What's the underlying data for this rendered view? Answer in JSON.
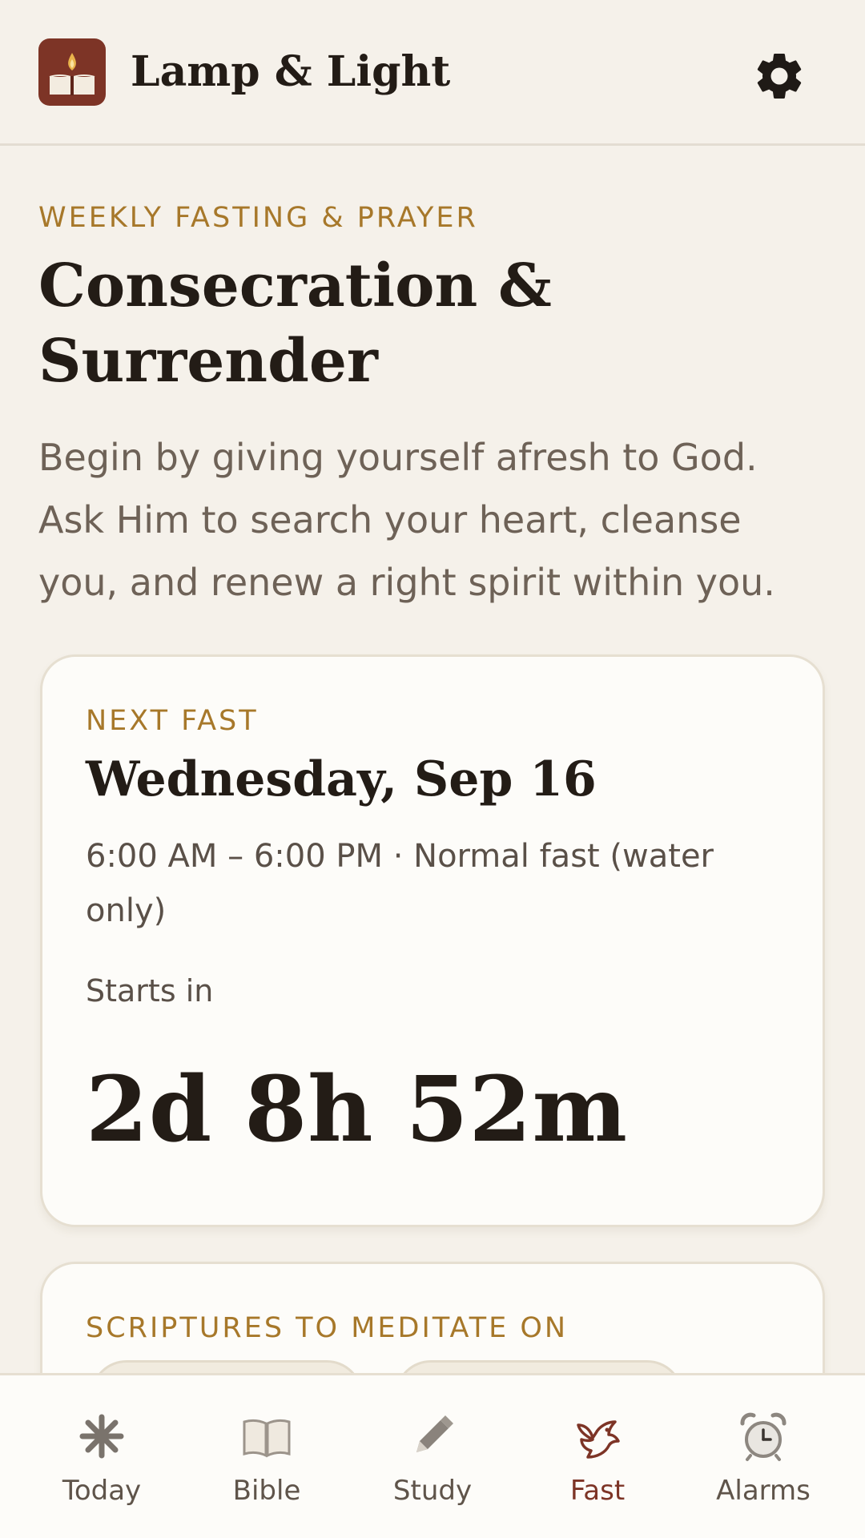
{
  "app": {
    "title": "Lamp & Light"
  },
  "intro": {
    "eyebrow": "WEEKLY FASTING & PRAYER",
    "title": "Consecration & Surrender",
    "description": "Begin by giving yourself afresh to God. Ask Him to search your heart, cleanse you, and renew a right spirit within you."
  },
  "next_fast": {
    "label": "NEXT FAST",
    "date": "Wednesday, Sep 16",
    "details": "6:00 AM – 6:00 PM · Normal fast (water only)",
    "starts_label": "Starts in",
    "countdown": "2d 8h 52m"
  },
  "scriptures": {
    "label": "SCRIPTURES TO MEDITATE ON"
  },
  "nav": {
    "items": [
      {
        "label": "Today",
        "icon": "sparkle-icon"
      },
      {
        "label": "Bible",
        "icon": "open-book-icon"
      },
      {
        "label": "Study",
        "icon": "pencil-icon"
      },
      {
        "label": "Fast",
        "icon": "dove-icon"
      },
      {
        "label": "Alarms",
        "icon": "alarm-clock-icon"
      }
    ],
    "active": "Fast"
  },
  "colors": {
    "accent": "#7d3426",
    "gold": "#a7782a",
    "background": "#f5f1ea",
    "card": "#fdfcf9"
  }
}
